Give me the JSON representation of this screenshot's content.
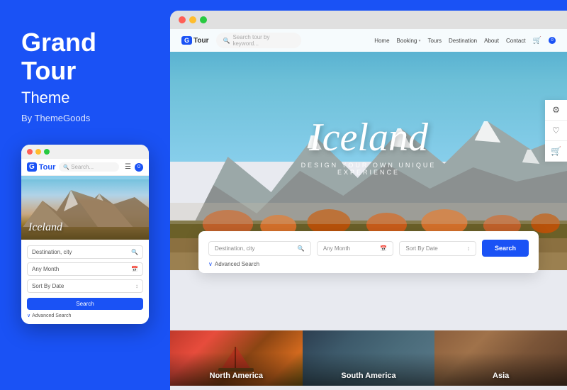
{
  "left": {
    "title_line1": "Grand",
    "title_line2": "Tour",
    "subtitle": "Theme",
    "by_line": "By ThemeGoods",
    "mobile_dots": [
      "red",
      "yellow",
      "green"
    ],
    "mobile_logo_prefix": "G",
    "mobile_logo_text": "Tour",
    "mobile_search_placeholder": "Search...",
    "mobile_hero_text": "Iceland",
    "mobile_form": {
      "destination_placeholder": "Destination, city",
      "month_placeholder": "Any Month",
      "sort_placeholder": "Sort By Date",
      "search_button": "Search",
      "advanced_label": "Advanced Search"
    }
  },
  "right": {
    "browser_dots": [
      "red",
      "yellow",
      "green"
    ],
    "nav": {
      "logo_prefix": "G",
      "logo_text": "Tour",
      "search_placeholder": "Search tour by keyword...",
      "links": [
        "Home",
        "Booking",
        "Tours",
        "Destination",
        "About",
        "Contact"
      ],
      "booking_has_dropdown": true,
      "cart_count": "0"
    },
    "hero": {
      "title": "Iceland",
      "subtitle": "DESIGN YOUR OWN UNIQUE EXPERIENCE"
    },
    "sidebar_tools": [
      "⚙",
      "♡",
      "🛒"
    ],
    "search_form": {
      "destination_placeholder": "Destination, city",
      "month_placeholder": "Any Month",
      "sort_placeholder": "Sort By Date",
      "search_button": "Search",
      "advanced_label": "Advanced Search"
    },
    "destination_cards": [
      {
        "label": "North America",
        "id": "north-america"
      },
      {
        "label": "South America",
        "id": "south-america"
      },
      {
        "label": "Asia",
        "id": "asia"
      }
    ]
  }
}
